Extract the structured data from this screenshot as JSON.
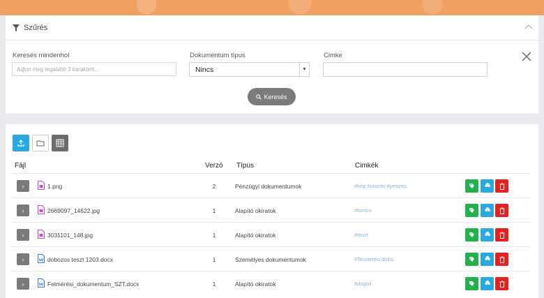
{
  "filter": {
    "title": "Szűrés",
    "search_label": "Keresés mindenhol",
    "search_placeholder": "Adjon meg legalább 3 karaktert...",
    "doctype_label": "Dokumentum típus",
    "doctype_value": "Nincs",
    "tag_label": "Cimke",
    "tag_value": "",
    "search_button": "Keresés"
  },
  "table": {
    "headers": {
      "file": "Fájl",
      "version": "Verzó",
      "type": "Típus",
      "tags": "Cimkék"
    },
    "rows": [
      {
        "name": "1.png",
        "version": "2",
        "type": "Pénzügyi dokumentumok",
        "tags": "#kép #utazás #pénzes",
        "kind": "image"
      },
      {
        "name": "2669097_14622.jpg",
        "version": "1",
        "type": "Alapító okiratok",
        "tags": "#fontos",
        "kind": "image"
      },
      {
        "name": "3031101_148.jpg",
        "version": "1",
        "type": "Alapító okiratok",
        "tags": "#teszt",
        "kind": "image"
      },
      {
        "name": "dobozos teszt 1203.docx",
        "version": "1",
        "type": "Személyes dokumentumok",
        "tags": "#Tesztelési doksi",
        "kind": "word"
      },
      {
        "name": "Felmérési_dokumentum_SZT.docx",
        "version": "1",
        "type": "Alapító okiratok",
        "tags": "#dsgsd",
        "kind": "word"
      }
    ]
  },
  "colors": {
    "accent": "#2aa8e0",
    "tag_btn": "#22b14c",
    "download_btn": "#2aa8e0",
    "delete_btn": "#e52222",
    "banner": "#f0a060"
  },
  "icons": [
    "filter-icon",
    "chevron-up-icon",
    "close-icon",
    "search-icon",
    "upload-icon",
    "folder-icon",
    "table-icon",
    "tag-icon",
    "cloud-download-icon",
    "trash-icon"
  ]
}
